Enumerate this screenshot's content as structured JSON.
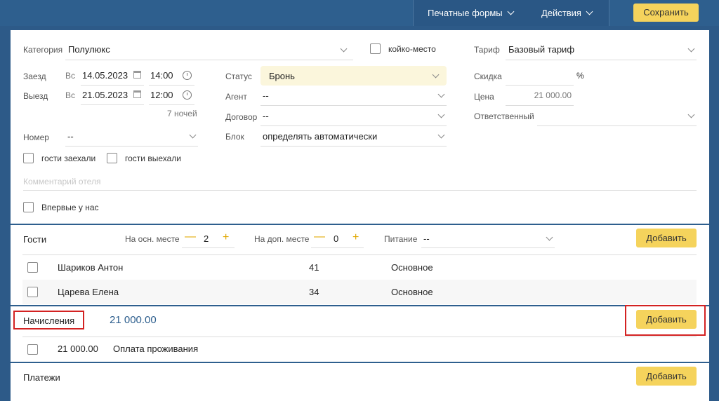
{
  "topbar": {
    "print_forms": "Печатные формы",
    "actions": "Действия",
    "save": "Сохранить"
  },
  "form": {
    "category_label": "Категория",
    "category_value": "Полулюкс",
    "bed_place_label": "койко-место",
    "tariff_label": "Тариф",
    "tariff_value": "Базовый тариф",
    "checkin_label": "Заезд",
    "checkin_day": "Вс",
    "checkin_date": "14.05.2023",
    "checkin_time": "14:00",
    "checkout_label": "Выезд",
    "checkout_day": "Вс",
    "checkout_date": "21.05.2023",
    "checkout_time": "12:00",
    "nights": "7 ночей",
    "status_label": "Статус",
    "status_value": "Бронь",
    "agent_label": "Агент",
    "agent_value": "--",
    "contract_label": "Договор",
    "contract_value": "--",
    "block_label": "Блок",
    "block_value": "определять автоматически",
    "discount_label": "Скидка",
    "discount_unit": "%",
    "price_label": "Цена",
    "price_value": "21 000.00",
    "responsible_label": "Ответственный",
    "room_label": "Номер",
    "room_value": "--",
    "guests_in": "гости заехали",
    "guests_out": "гости выехали",
    "comment_placeholder": "Комментарий отеля",
    "first_time": "Впервые у нас"
  },
  "guests": {
    "title": "Гости",
    "main_place_label": "На осн. месте",
    "main_place_value": "2",
    "extra_place_label": "На доп. месте",
    "extra_place_value": "0",
    "meal_label": "Питание",
    "meal_value": "--",
    "add": "Добавить",
    "rows": [
      {
        "name": "Шариков Антон",
        "age": "41",
        "place": "Основное"
      },
      {
        "name": "Царева Елена",
        "age": "34",
        "place": "Основное"
      }
    ]
  },
  "charges": {
    "title": "Начисления",
    "total": "21 000.00",
    "add": "Добавить",
    "rows": [
      {
        "amount": "21 000.00",
        "desc": "Оплата проживания"
      }
    ]
  },
  "payments": {
    "title": "Платежи",
    "add": "Добавить"
  },
  "colors": {
    "header": "#2e5f8e",
    "accent_button": "#f5d35c",
    "highlight": "#d32222"
  }
}
